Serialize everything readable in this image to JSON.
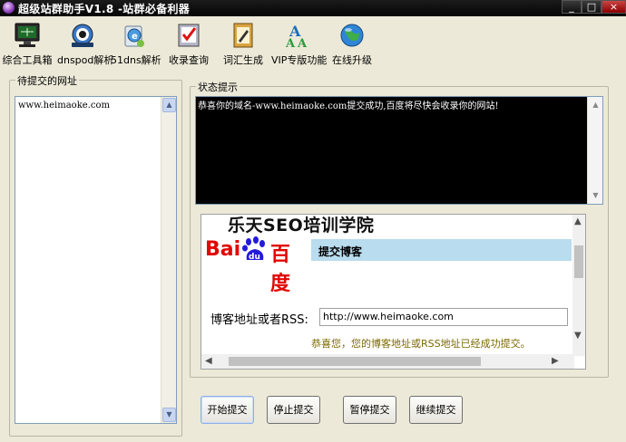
{
  "window": {
    "title": "超级站群助手V1.8 -站群必备利器",
    "min_glyph": "_",
    "max_glyph": "□",
    "close_glyph": "×"
  },
  "toolbar": {
    "items": [
      {
        "label": "综合工具箱",
        "icon": "monitor-toolbox-icon"
      },
      {
        "label": "dnspod解析",
        "icon": "dnspod-icon"
      },
      {
        "label": "51dns解析",
        "icon": "dns-globe-icon"
      },
      {
        "label": "收录查询",
        "icon": "checklist-icon"
      },
      {
        "label": "词汇生成",
        "icon": "notepad-icon"
      },
      {
        "label": "VIP专版功能",
        "icon": "font-tool-icon"
      },
      {
        "label": "在线升级",
        "icon": "globe-update-icon"
      }
    ]
  },
  "left_panel": {
    "title": "待提交的网址",
    "urls": [
      "www.heimaoke.com"
    ]
  },
  "right_panel": {
    "title": "状态提示",
    "console_message": "恭喜你的域名-www.heimaoke.com提交成功,百度将尽快会收录你的网站!"
  },
  "embedded": {
    "watermark": "乐天SEO培训学院",
    "baidu_left": "Bai",
    "baidu_right": "百度",
    "baidu_paw_text": "du",
    "bar_title": "提交博客",
    "field_label": "博客地址或者RSS:",
    "field_value": "http://www.heimaoke.com",
    "success_message": "恭喜您，您的博客地址或RSS地址已经成功提交。"
  },
  "buttons": {
    "start": "开始提交",
    "stop": "停止提交",
    "pause": "暂停提交",
    "resume": "继续提交"
  },
  "colors": {
    "accent_red": "#e10601",
    "bar_blue": "#b9dcee",
    "console_bg": "#000000"
  }
}
